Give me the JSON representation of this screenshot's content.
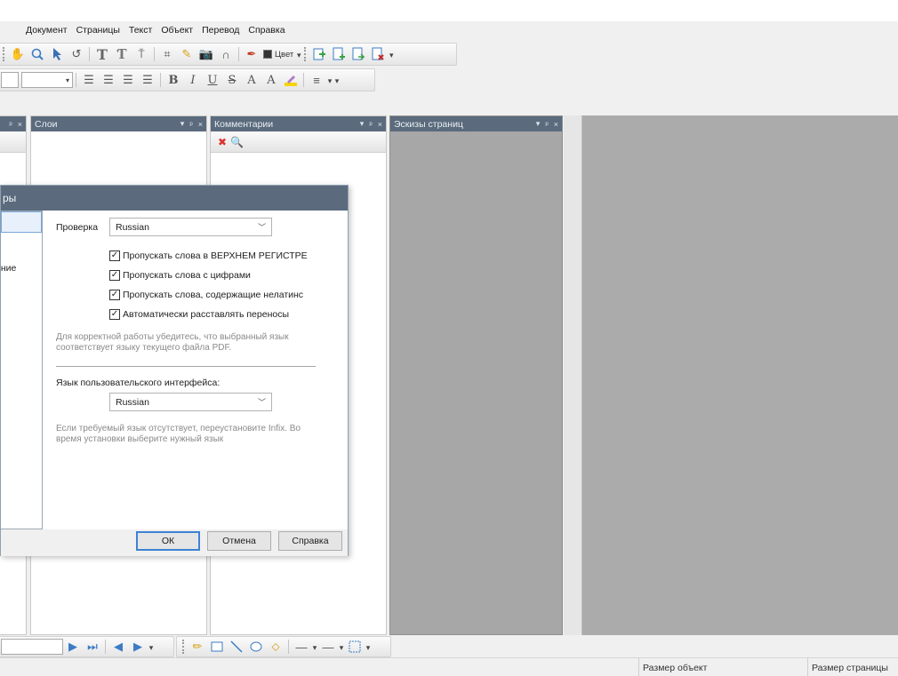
{
  "menu": [
    "Документ",
    "Страницы",
    "Текст",
    "Объект",
    "Перевод",
    "Справка"
  ],
  "toolbar": {
    "color_label": "Цвет",
    "bold": "B",
    "italic": "I",
    "underline": "U",
    "strike": "S",
    "superscript": "A",
    "subscript": "A",
    "text_tool": "T"
  },
  "panels": {
    "layers": {
      "title": "Слои"
    },
    "comments": {
      "title": "Комментарии"
    },
    "thumbs": {
      "title": "Эскизы страниц"
    },
    "ctrl_dropdown": "▾",
    "ctrl_pin": "ᵖ",
    "ctrl_close": "×"
  },
  "dialog": {
    "title_fragment": "ры",
    "nav_items": [
      {
        "label": "",
        "selected": true
      },
      {
        "label": "а",
        "link": true
      },
      {
        "label": "ение"
      },
      {
        "label": "а"
      }
    ],
    "spell_label": "Проверка",
    "spell_language": "Russian",
    "checks": [
      {
        "label": "Пропускать слова в ВЕРХНЕМ РЕГИСТРЕ",
        "checked": true
      },
      {
        "label": "Пропускать слова с цифрами",
        "checked": true
      },
      {
        "label": "Пропускать слова, содержащие нелатинс",
        "checked": true
      },
      {
        "label": "Автоматически расставлять переносы",
        "checked": true
      }
    ],
    "hint1": "Для корректной работы убедитесь, что выбранный язык соответствует языку текущего файла PDF.",
    "ui_lang_label": "Язык пользовательского интерфейса:",
    "ui_language": "Russian",
    "hint2": "Если требуемый язык отсутствует, переустановите Infix. Во время установки выберите нужный язык",
    "ok": "ОК",
    "cancel": "Отмена",
    "help": "Справка"
  },
  "status": {
    "object_size": "Размер объект",
    "page_size": "Размер страницы"
  },
  "colors": {
    "panel_header": "#5b6b7d",
    "doc_bg": "#ababab",
    "accent": "#3d83d4"
  }
}
